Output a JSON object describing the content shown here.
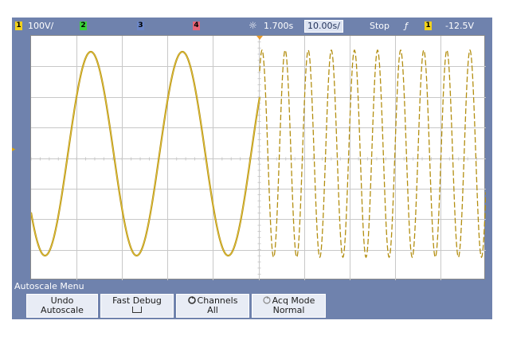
{
  "status": {
    "ch1_num": "1",
    "ch1_scale": "100V/",
    "ch2_num": "2",
    "ch3_num": "3",
    "ch4_num": "4",
    "time_delay": "1.700s",
    "time_div": "10.00s/",
    "run_state": "Stop",
    "trigger_slope": "ƒ",
    "trigger_source": "1",
    "trigger_level": "-12.5V"
  },
  "colors": {
    "ch1": "#f2d21b",
    "ch2": "#3bd13b",
    "ch3": "#6b86c6",
    "ch4": "#e86477",
    "trace": "#b38e10",
    "panel": "#6f82ad"
  },
  "menu": {
    "title": "Autoscale Menu",
    "softkeys": [
      {
        "line1": "Undo",
        "line2": "Autoscale"
      },
      {
        "line1": "Fast Debug",
        "line2": ""
      },
      {
        "line1": "Channels",
        "line2": "All"
      },
      {
        "line1": "Acq Mode",
        "line2": "Normal"
      }
    ]
  }
}
